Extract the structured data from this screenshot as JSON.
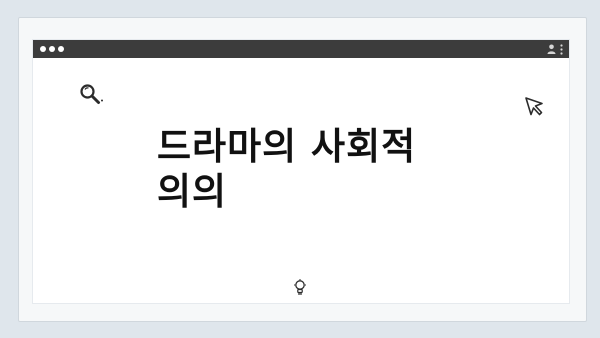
{
  "pager": {
    "dots": 4
  },
  "window": {
    "titlebar_color": "#3c3c3c",
    "traffic_lights": 3
  },
  "icons": {
    "search": "search-icon",
    "cursor": "cursor-icon",
    "user": "user-icon",
    "more": "more-vertical-icon",
    "bulb": "lightbulb-icon"
  },
  "content": {
    "title": "드라마의 사회적 의의"
  },
  "colors": {
    "background": "#dfe6ec",
    "card": "#f6f8f9",
    "window": "#ffffff",
    "text": "#111111"
  }
}
